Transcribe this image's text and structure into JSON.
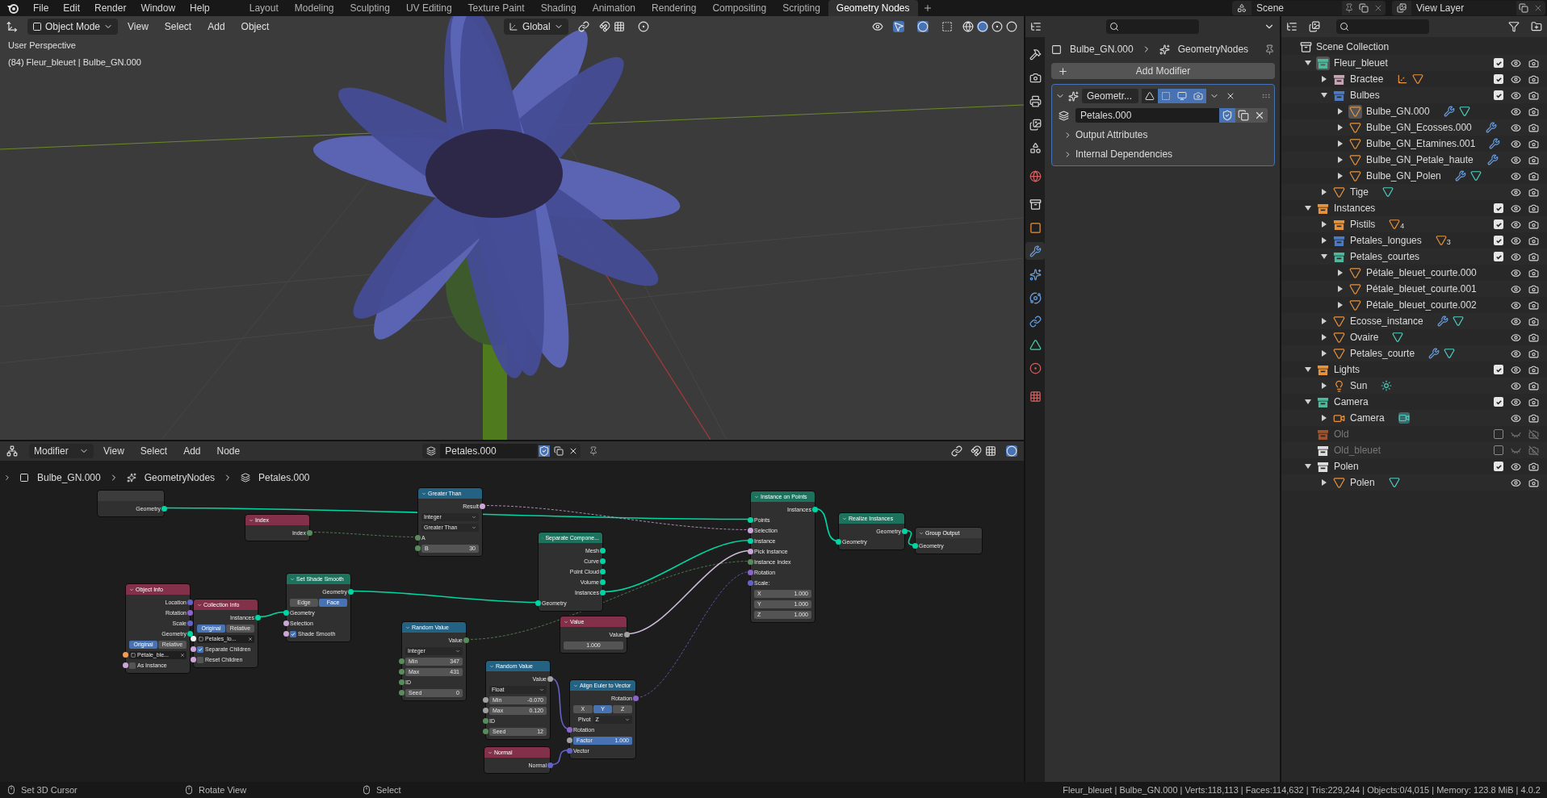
{
  "top_bar": {
    "menus": [
      "File",
      "Edit",
      "Render",
      "Window",
      "Help"
    ],
    "workspaces": [
      {
        "label": "Layout",
        "selected": false
      },
      {
        "label": "Modeling",
        "selected": false
      },
      {
        "label": "Sculpting",
        "selected": false
      },
      {
        "label": "UV Editing",
        "selected": false
      },
      {
        "label": "Texture Paint",
        "selected": false
      },
      {
        "label": "Shading",
        "selected": false
      },
      {
        "label": "Animation",
        "selected": false
      },
      {
        "label": "Rendering",
        "selected": false
      },
      {
        "label": "Compositing",
        "selected": false
      },
      {
        "label": "Scripting",
        "selected": false
      },
      {
        "label": "Geometry Nodes",
        "selected": true
      }
    ],
    "scene": "Scene",
    "view_layer": "View Layer"
  },
  "viewport": {
    "mode": "Object Mode",
    "menus": [
      "View",
      "Select",
      "Add",
      "Object"
    ],
    "orientation": "Global",
    "overlay_lines": [
      "User Perspective",
      "(84) Fleur_bleuet | Bulbe_GN.000"
    ]
  },
  "node_editor": {
    "context": "Modifier",
    "menus": [
      "View",
      "Select",
      "Add",
      "Node"
    ],
    "node_group": "Petales.000",
    "breadcrumb": [
      "Bulbe_GN.000",
      "GeometryNodes",
      "Petales.000"
    ],
    "nodes": [
      {
        "color": "#3c3c3c",
        "rows": [
          {
            "kind": "output",
            "label": "Geometry",
            "color": "#00d6a3"
          }
        ]
      },
      {
        "title": "Index",
        "color": "#83314a",
        "rows": [
          {
            "kind": "output",
            "label": "Index",
            "color": "#598c5c"
          }
        ]
      },
      {
        "title": "Greater Than",
        "color": "#246283",
        "rows": [
          {
            "kind": "output",
            "label": "Result",
            "color": "#cca6d6"
          },
          {
            "kind": "dropdown",
            "value": "Integer"
          },
          {
            "kind": "dropdown",
            "value": "Greater Than"
          },
          {
            "kind": "input",
            "label": "A",
            "color": "#598c5c"
          },
          {
            "kind": "field",
            "label": "B",
            "value": "30",
            "color": "#598c5c"
          }
        ]
      },
      {
        "title": "Object Info",
        "color": "#83314a",
        "rows": [
          {
            "kind": "output",
            "label": "Location",
            "color": "#6363c7"
          },
          {
            "kind": "output",
            "label": "Rotation",
            "color": "#8c63c7"
          },
          {
            "kind": "output",
            "label": "Scale",
            "color": "#6363c7"
          },
          {
            "kind": "output",
            "label": "Geometry",
            "color": "#00d6a3"
          },
          {
            "kind": "toggle",
            "options": [
              {
                "label": "Original",
                "selected": true
              },
              {
                "label": "Relative",
                "selected": false
              }
            ]
          },
          {
            "kind": "object",
            "value": "Pétale_ble...",
            "color": "#ed9e5c"
          },
          {
            "kind": "checkbox",
            "label": "As Instance",
            "checked": false,
            "color": "#cca6d6"
          }
        ]
      },
      {
        "title": "Collection Info",
        "color": "#83314a",
        "rows": [
          {
            "kind": "output",
            "label": "Instances",
            "color": "#00d6a3"
          },
          {
            "kind": "toggle",
            "options": [
              {
                "label": "Original",
                "selected": true
              },
              {
                "label": "Relative",
                "selected": false
              }
            ]
          },
          {
            "kind": "object",
            "value": "Petales_lo...",
            "color": "#f5f5f5"
          },
          {
            "kind": "checkbox",
            "label": "Separate Children",
            "checked": true,
            "color": "#cca6d6"
          },
          {
            "kind": "checkbox",
            "label": "Reset Children",
            "checked": false,
            "color": "#cca6d6"
          }
        ]
      },
      {
        "title": "Set Shade Smooth",
        "color": "#1d725e",
        "rows": [
          {
            "kind": "output",
            "label": "Geometry",
            "color": "#00d6a3"
          },
          {
            "kind": "toggle",
            "options": [
              {
                "label": "Edge",
                "selected": false
              },
              {
                "label": "Face",
                "selected": true
              }
            ]
          },
          {
            "kind": "input",
            "label": "Geometry",
            "color": "#00d6a3"
          },
          {
            "kind": "input",
            "label": "Selection",
            "color": "#cca6d6"
          },
          {
            "kind": "checkbox",
            "label": "Shade Smooth",
            "checked": true,
            "color": "#cca6d6"
          }
        ]
      },
      {
        "title": "Random Value",
        "color": "#246283",
        "rows": [
          {
            "kind": "output",
            "label": "Value",
            "color": "#598c5c"
          },
          {
            "kind": "dropdown",
            "value": "Integer"
          },
          {
            "kind": "field",
            "label": "Min",
            "value": "347",
            "color": "#598c5c"
          },
          {
            "kind": "field",
            "label": "Max",
            "value": "431",
            "color": "#598c5c"
          },
          {
            "kind": "input",
            "label": "ID",
            "color": "#598c5c"
          },
          {
            "kind": "field",
            "label": "Seed",
            "value": "0",
            "color": "#598c5c"
          }
        ]
      },
      {
        "title": "Separate Compone...",
        "color": "#1d725e",
        "rows": [
          {
            "kind": "output",
            "label": "Mesh",
            "color": "#00d6a3"
          },
          {
            "kind": "output",
            "label": "Curve",
            "color": "#00d6a3"
          },
          {
            "kind": "output",
            "label": "Point Cloud",
            "color": "#00d6a3"
          },
          {
            "kind": "output",
            "label": "Volume",
            "color": "#00d6a3"
          },
          {
            "kind": "output",
            "label": "Instances",
            "color": "#00d6a3"
          },
          {
            "kind": "input",
            "label": "Geometry",
            "color": "#00d6a3"
          }
        ]
      },
      {
        "title": "Value",
        "color": "#83314a",
        "rows": [
          {
            "kind": "output",
            "label": "Value",
            "color": "#a1a1a1"
          },
          {
            "kind": "field",
            "value": "1.000"
          }
        ]
      },
      {
        "title": "Random Value",
        "color": "#246283",
        "rows": [
          {
            "kind": "output",
            "label": "Value",
            "color": "#a1a1a1"
          },
          {
            "kind": "dropdown",
            "value": "Float"
          },
          {
            "kind": "field",
            "label": "Min",
            "value": "-0.070",
            "color": "#a1a1a1"
          },
          {
            "kind": "field",
            "label": "Max",
            "value": "0.120",
            "color": "#a1a1a1"
          },
          {
            "kind": "input",
            "label": "ID",
            "color": "#598c5c"
          },
          {
            "kind": "field",
            "label": "Seed",
            "value": "12",
            "color": "#598c5c"
          }
        ]
      },
      {
        "title": "Normal",
        "color": "#83314a",
        "rows": [
          {
            "kind": "output",
            "label": "Normal",
            "color": "#6363c7"
          }
        ]
      },
      {
        "title": "Align Euler to Vector",
        "color": "#246283",
        "rows": [
          {
            "kind": "output",
            "label": "Rotation",
            "color": "#8c63c7"
          },
          {
            "kind": "toggle",
            "options": [
              {
                "label": "X",
                "selected": false
              },
              {
                "label": "Y",
                "selected": true
              },
              {
                "label": "Z",
                "selected": false
              }
            ]
          },
          {
            "kind": "dropdown",
            "label": "Pivot",
            "value": "Z"
          },
          {
            "kind": "input",
            "label": "Rotation",
            "color": "#8c63c7"
          },
          {
            "kind": "slider",
            "label": "Factor",
            "value": "1.000",
            "level": 1,
            "color": "#a1a1a1"
          },
          {
            "kind": "input",
            "label": "Vector",
            "color": "#6363c7"
          }
        ]
      },
      {
        "title": "Instance on Points",
        "color": "#1d725e",
        "rows": [
          {
            "kind": "output",
            "label": "Instances",
            "color": "#00d6a3"
          },
          {
            "kind": "input",
            "label": "Points",
            "color": "#00d6a3"
          },
          {
            "kind": "input",
            "label": "Selection",
            "color": "#cca6d6"
          },
          {
            "kind": "input",
            "label": "Instance",
            "color": "#00d6a3"
          },
          {
            "kind": "input",
            "label": "Pick Instance",
            "color": "#cca6d6"
          },
          {
            "kind": "input",
            "label": "Instance Index",
            "color": "#598c5c"
          },
          {
            "kind": "input",
            "label": "Rotation",
            "color": "#8c63c7"
          },
          {
            "kind": "input",
            "label": "Scale:",
            "color": "#6363c7"
          },
          {
            "kind": "field",
            "label": "X",
            "value": "1.000"
          },
          {
            "kind": "field",
            "label": "Y",
            "value": "1.000"
          },
          {
            "kind": "field",
            "label": "Z",
            "value": "1.000"
          }
        ]
      },
      {
        "title": "Realize Instances",
        "color": "#1d725e",
        "rows": [
          {
            "kind": "output",
            "label": "Geometry",
            "color": "#00d6a3"
          },
          {
            "kind": "input",
            "label": "Geometry",
            "color": "#00d6a3"
          }
        ]
      },
      {
        "title": "Group Output",
        "color": "#3c3c3c",
        "rows": [
          {
            "kind": "input",
            "label": "Geometry",
            "color": "#00d6a3"
          }
        ]
      }
    ]
  },
  "properties": {
    "tabs": [
      {
        "kind": "tool",
        "selected": false
      },
      {
        "kind": "render",
        "selected": false
      },
      {
        "kind": "output",
        "selected": false
      },
      {
        "kind": "view_layer",
        "selected": false
      },
      {
        "kind": "scene",
        "selected": false
      },
      {
        "kind": "world",
        "selected": false
      },
      {
        "kind": "collection",
        "selected": false
      },
      {
        "kind": "object",
        "selected": false
      },
      {
        "kind": "modifier",
        "selected": true
      },
      {
        "kind": "particles",
        "selected": false
      },
      {
        "kind": "physics",
        "selected": false
      },
      {
        "kind": "constraints",
        "selected": false
      },
      {
        "kind": "data",
        "selected": false
      },
      {
        "kind": "material",
        "selected": false
      },
      {
        "kind": "texture",
        "selected": false
      }
    ],
    "breadcrumb": [
      "Bulbe_GN.000",
      "GeometryNodes"
    ],
    "add_modifier": "Add Modifier",
    "modifier": {
      "name": "Geometr...",
      "expanded": true,
      "toggles": [
        {
          "kind": "edit_mode",
          "on": false
        },
        {
          "kind": "on_cage",
          "on": true
        },
        {
          "kind": "viewport",
          "on": true
        },
        {
          "kind": "render",
          "on": true
        }
      ],
      "node_group": "Petales.000",
      "fake_user": true,
      "subpanels": [
        {
          "label": "Output Attributes",
          "expanded": false
        },
        {
          "label": "Internal Dependencies",
          "expanded": false
        }
      ]
    }
  },
  "outliner": {
    "items": [
      {
        "name": "Scene Collection",
        "kind": "scene_collection",
        "children": [
          {
            "name": "Fleur_bleuet",
            "kind": "collection",
            "color": "#4cb89c",
            "selected": true,
            "expanded": true,
            "checked": true,
            "children": [
              {
                "name": "Bractee",
                "kind": "collection",
                "color": "#c9a3b4",
                "selected": false,
                "expanded": false,
                "checked": true,
                "extras": [
                  {
                    "kind": "empty"
                  },
                  {
                    "kind": "mesh"
                  }
                ]
              },
              {
                "name": "Bulbes",
                "kind": "collection",
                "color": "#4c7ac4",
                "selected": false,
                "expanded": true,
                "checked": true,
                "children": [
                  {
                    "name": "Bulbe_GN.000",
                    "kind": "mesh",
                    "selected": true,
                    "expanded": false,
                    "extras": [
                      {
                        "kind": "modifier"
                      },
                      {
                        "kind": "mesh_data"
                      }
                    ]
                  },
                  {
                    "name": "Bulbe_GN_Ecosses.000",
                    "kind": "mesh",
                    "selected": false,
                    "expanded": false,
                    "extras": [
                      {
                        "kind": "modifier"
                      }
                    ]
                  },
                  {
                    "name": "Bulbe_GN_Etamines.001",
                    "kind": "mesh",
                    "selected": false,
                    "expanded": false,
                    "extras": [
                      {
                        "kind": "modifier"
                      }
                    ]
                  },
                  {
                    "name": "Bulbe_GN_Petale_haute",
                    "kind": "mesh",
                    "selected": false,
                    "expanded": false,
                    "extras": [
                      {
                        "kind": "modifier"
                      }
                    ]
                  },
                  {
                    "name": "Bulbe_GN_Polen",
                    "kind": "mesh",
                    "selected": false,
                    "expanded": false,
                    "extras": [
                      {
                        "kind": "modifier"
                      },
                      {
                        "kind": "mesh_data"
                      }
                    ]
                  }
                ]
              },
              {
                "name": "Tige",
                "kind": "mesh",
                "selected": false,
                "expanded": false,
                "extras": [
                  {
                    "kind": "mesh_data"
                  }
                ]
              }
            ]
          },
          {
            "name": "Instances",
            "kind": "collection",
            "color": "#e8923c",
            "selected": false,
            "expanded": true,
            "checked": true,
            "children": [
              {
                "name": "Pistils",
                "kind": "collection",
                "color": "#e8923c",
                "selected": false,
                "expanded": false,
                "checked": true,
                "extras": [
                  {
                    "kind": "mesh",
                    "count": "4"
                  }
                ]
              },
              {
                "name": "Petales_longues",
                "kind": "collection",
                "color": "#4c7ac4",
                "selected": false,
                "expanded": false,
                "checked": true,
                "extras": [
                  {
                    "kind": "mesh",
                    "count": "3"
                  }
                ]
              },
              {
                "name": "Petales_courtes",
                "kind": "collection",
                "color": "#4cb89c",
                "selected": false,
                "expanded": true,
                "checked": true,
                "children": [
                  {
                    "name": "Pétale_bleuet_courte.000",
                    "kind": "mesh",
                    "selected": false,
                    "expanded": false
                  },
                  {
                    "name": "Pétale_bleuet_courte.001",
                    "kind": "mesh",
                    "selected": false,
                    "expanded": false
                  },
                  {
                    "name": "Pétale_bleuet_courte.002",
                    "kind": "mesh",
                    "selected": false,
                    "expanded": false
                  }
                ]
              },
              {
                "name": "Ecosse_instance",
                "kind": "mesh",
                "selected": false,
                "expanded": false,
                "extras": [
                  {
                    "kind": "modifier"
                  },
                  {
                    "kind": "mesh_data"
                  }
                ]
              },
              {
                "name": "Ovaire",
                "kind": "mesh",
                "selected": false,
                "expanded": false,
                "extras": [
                  {
                    "kind": "mesh_data"
                  }
                ]
              },
              {
                "name": "Petales_courte",
                "kind": "mesh",
                "selected": false,
                "expanded": false,
                "extras": [
                  {
                    "kind": "modifier"
                  },
                  {
                    "kind": "mesh_data"
                  }
                ]
              }
            ]
          },
          {
            "name": "Lights",
            "kind": "collection",
            "color": "#e8923c",
            "selected": false,
            "expanded": true,
            "checked": true,
            "children": [
              {
                "name": "Sun",
                "kind": "light",
                "selected": false,
                "expanded": false,
                "extras": [
                  {
                    "kind": "sun"
                  }
                ]
              }
            ]
          },
          {
            "name": "Camera",
            "kind": "collection",
            "color": "#4cb89c",
            "selected": false,
            "expanded": true,
            "checked": true,
            "children": [
              {
                "name": "Camera",
                "kind": "camera",
                "selected": false,
                "expanded": false,
                "extras": [
                  {
                    "kind": "camera_data"
                  }
                ]
              }
            ]
          },
          {
            "name": "Old",
            "kind": "collection",
            "color": "#a0522d",
            "selected": false,
            "checked": false
          },
          {
            "name": "Old_bleuet",
            "kind": "collection",
            "color": "#dddddd",
            "selected": false,
            "checked": false
          },
          {
            "name": "Polen",
            "kind": "collection",
            "color": "#dddddd",
            "selected": false,
            "expanded": true,
            "checked": true,
            "children": [
              {
                "name": "Polen",
                "kind": "mesh",
                "selected": false,
                "expanded": false,
                "extras": [
                  {
                    "kind": "mesh_data"
                  }
                ]
              }
            ]
          }
        ]
      }
    ]
  },
  "status_bar": {
    "hints": [
      "Set 3D Cursor",
      "Rotate View",
      "Select"
    ],
    "stats": "Fleur_bleuet | Bulbe_GN.000 | Verts:118,113 | Faces:114,632 | Tris:229,244 | Objects:0/4,015 | Memory: 123.8 MiB | 4.0.2"
  }
}
